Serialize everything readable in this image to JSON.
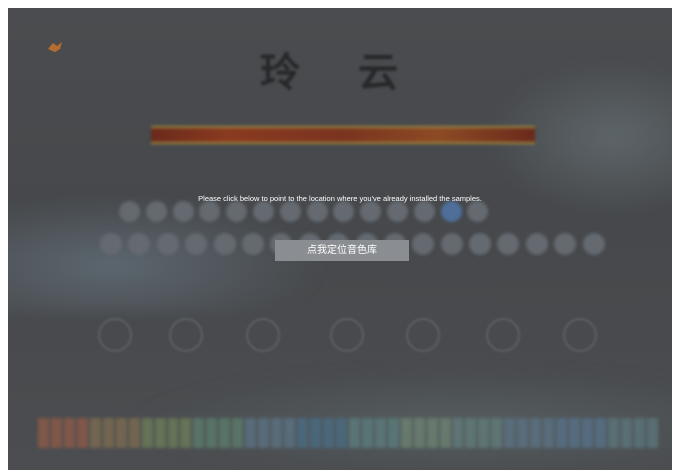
{
  "app": {
    "title": "玲 云",
    "banner_color": "#8a3a20",
    "logo_icon": "orange-logo-icon"
  },
  "overlay": {
    "instruction": "Please click below to point to the location where you've already installed the samples.",
    "button_label": "点我定位音色库"
  },
  "background": {
    "sub_label": "",
    "knobs": [
      {
        "label": ""
      },
      {
        "label": ""
      },
      {
        "label": ""
      },
      {
        "label": ""
      },
      {
        "label": ""
      },
      {
        "label": ""
      },
      {
        "label": ""
      }
    ],
    "row1_count": 14,
    "row2_count": 18,
    "accent_blue": "#4e6f9a"
  }
}
